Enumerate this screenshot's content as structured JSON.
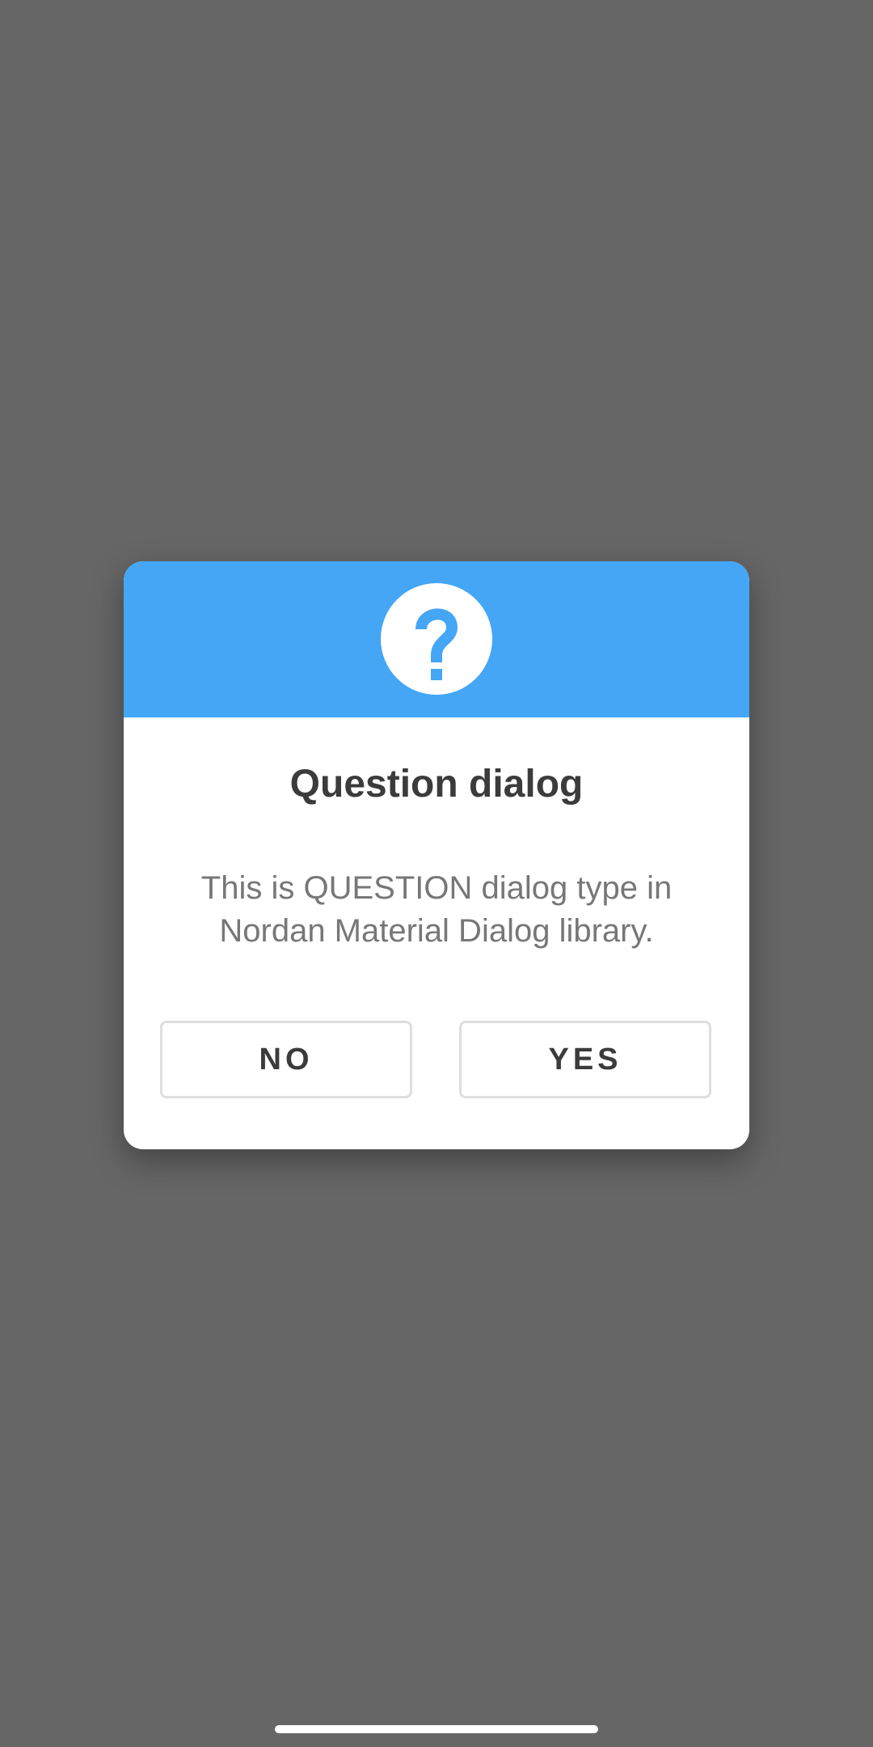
{
  "dialog": {
    "icon": "question-mark-icon",
    "title": "Question dialog",
    "message": "This is QUESTION dialog type in Nordan Material Dialog library.",
    "no_label": "NO",
    "yes_label": "YES"
  },
  "colors": {
    "header": "#44a6f5",
    "overlay": "#666666",
    "dialog_background": "#ffffff",
    "title_text": "#3b3b3b",
    "message_text": "#777777"
  }
}
